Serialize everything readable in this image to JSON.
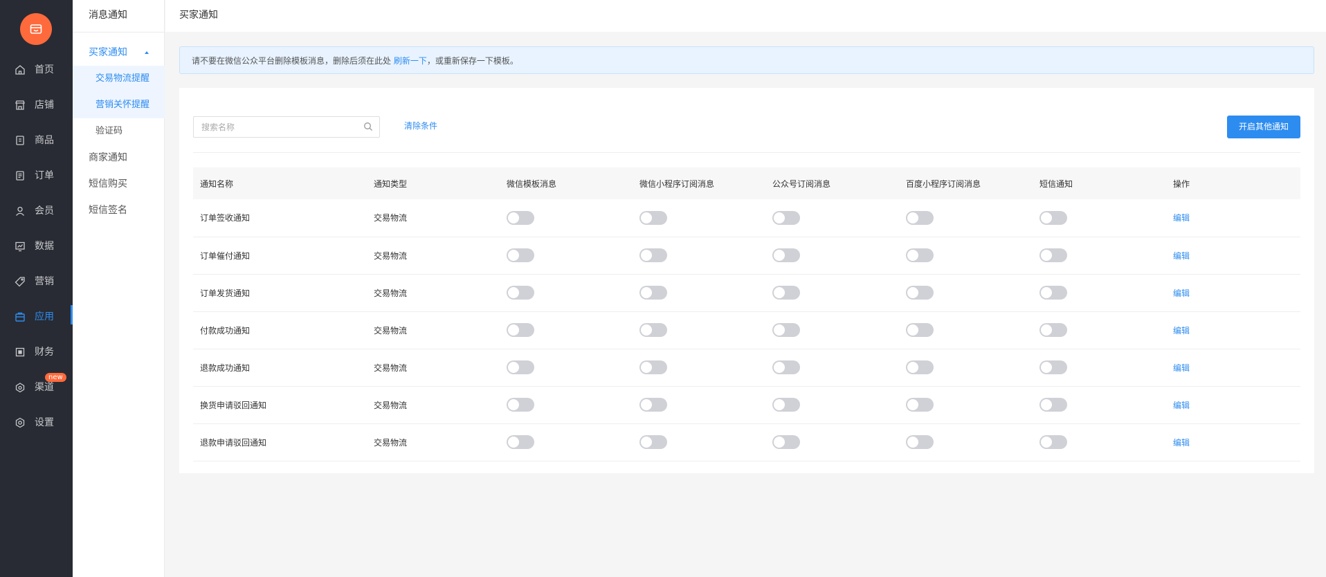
{
  "nav": {
    "items": [
      {
        "label": "首页",
        "icon": "home-icon"
      },
      {
        "label": "店铺",
        "icon": "store-icon"
      },
      {
        "label": "商品",
        "icon": "goods-icon"
      },
      {
        "label": "订单",
        "icon": "order-icon"
      },
      {
        "label": "会员",
        "icon": "member-icon"
      },
      {
        "label": "数据",
        "icon": "data-icon"
      },
      {
        "label": "营销",
        "icon": "tag-icon"
      },
      {
        "label": "应用",
        "icon": "app-icon"
      },
      {
        "label": "财务",
        "icon": "finance-icon"
      },
      {
        "label": "渠道",
        "icon": "channel-icon",
        "badge": "new"
      },
      {
        "label": "设置",
        "icon": "settings-icon"
      }
    ],
    "active_color": "#2d8cf0",
    "brand_color": "#ff6a3c"
  },
  "submenu": {
    "title": "消息通知",
    "items": [
      {
        "label": "买家通知"
      },
      {
        "label": "交易物流提醒"
      },
      {
        "label": "营销关怀提醒"
      },
      {
        "label": "验证码"
      },
      {
        "label": "商家通知"
      },
      {
        "label": "短信购买"
      },
      {
        "label": "短信签名"
      }
    ]
  },
  "header": {
    "title": "买家通知"
  },
  "alert": {
    "text_before": "请不要在微信公众平台删除模板消息，删除后须在此处",
    "link": "刷新一下",
    "text_after": "，或重新保存一下模板。"
  },
  "toolbar": {
    "search_placeholder": "搜索名称",
    "clear_label": "清除条件",
    "primary_button": "开启其他通知"
  },
  "table": {
    "columns": [
      "通知名称",
      "通知类型",
      "微信模板消息",
      "微信小程序订阅消息",
      "公众号订阅消息",
      "百度小程序订阅消息",
      "短信通知",
      "操作"
    ],
    "rows": [
      {
        "name": "订单签收通知",
        "type": "交易物流",
        "action": "编辑"
      },
      {
        "name": "订单催付通知",
        "type": "交易物流",
        "action": "编辑"
      },
      {
        "name": "订单发货通知",
        "type": "交易物流",
        "action": "编辑"
      },
      {
        "name": "付款成功通知",
        "type": "交易物流",
        "action": "编辑"
      },
      {
        "name": "退款成功通知",
        "type": "交易物流",
        "action": "编辑"
      },
      {
        "name": "换货申请驳回通知",
        "type": "交易物流",
        "action": "编辑"
      },
      {
        "name": "退款申请驳回通知",
        "type": "交易物流",
        "action": "编辑"
      }
    ],
    "toggle_state": "off"
  }
}
